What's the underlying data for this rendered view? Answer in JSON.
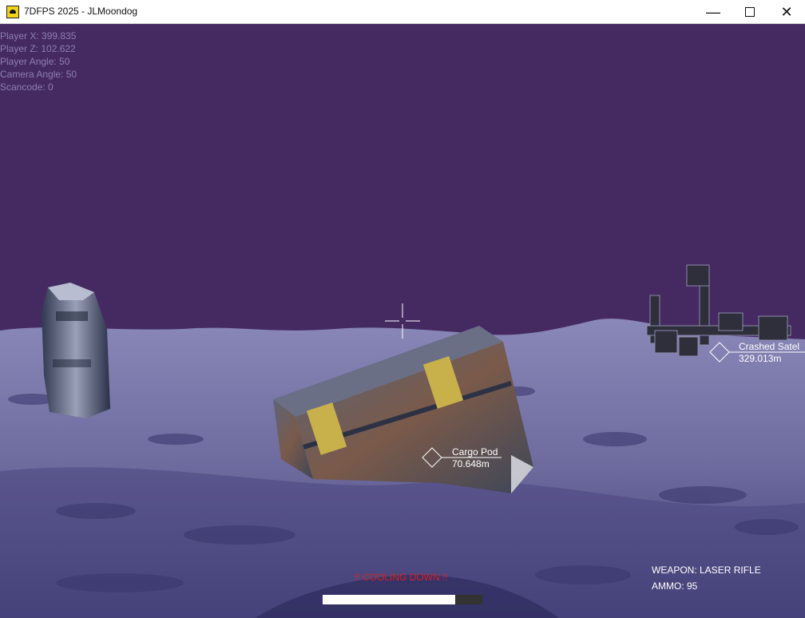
{
  "window": {
    "title": "7DFPS 2025 - JLMoondog",
    "icon": "moondog-app-icon",
    "minimize_glyph": "—",
    "close_glyph": "✕"
  },
  "debug": {
    "player_x": "Player X: 399.835",
    "player_z": "Player Z: 102.622",
    "player_angle": "Player Angle: 50",
    "camera_angle": "Camera Angle: 50",
    "scancode": "Scancode: 0"
  },
  "markers": [
    {
      "name": "Crashed Satel",
      "distance": "329.013m"
    },
    {
      "name": "Cargo Pod",
      "distance": "70.648m"
    }
  ],
  "hud": {
    "weapon": "WEAPON: LASER RIFLE",
    "ammo": "AMMO: 95",
    "cooldown": "!! COOLING DOWN !!",
    "cooldown_progress": 0.83
  },
  "colors": {
    "sky": "#452a62",
    "ground": "#6e6b9e",
    "alert": "#d92020",
    "hud_text": "#ffffff"
  }
}
